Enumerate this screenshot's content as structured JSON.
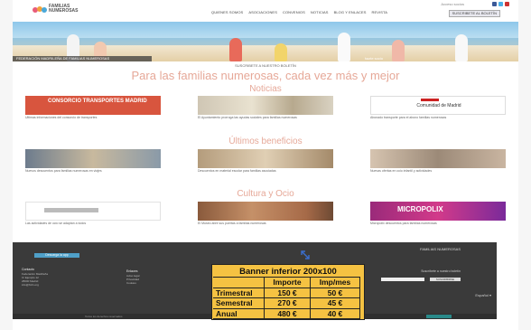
{
  "header": {
    "logo_text": "FAMILIAS NUMEROSAS",
    "top_links": "Acceso socios",
    "nav": [
      "QUIENES SOMOS",
      "ASOCIACIONES",
      "CONVENIOS",
      "NOTICIAS",
      "BLOG Y ENLACES",
      "REVISTA"
    ],
    "subscribe_button": "SUSCRIBETE AL BOLETÍN"
  },
  "hero": {
    "caption": "FEDERACIÓN MADRILEÑA DE FAMILIAS NUMEROSAS",
    "right_caption": "hazte socio"
  },
  "subscribe_line": "SUSCRIBETE A NUESTRO BOLETÍN",
  "tagline": "Para las familias numerosas, cada vez más y mejor",
  "sections": {
    "news_title": "Noticias",
    "benefits_title": "Últimos beneficios",
    "culture_title": "Cultura y Ocio"
  },
  "news": [
    {
      "label": "CONSORCIO TRANSPORTES MADRID",
      "text": "Ultimas informaciones del consorcio de transportes"
    },
    {
      "label": "",
      "text": "El Ayuntamiento prorroga las ayudas sociales para familias numerosas"
    },
    {
      "label": "Comunidad de Madrid",
      "text": "Abonado transporte para el abono familias numerosas"
    }
  ],
  "benefits": [
    {
      "text": "Nuevos descuentos para familias numerosas en viajes"
    },
    {
      "text": "Descuentos en material escolar para familias asociadas"
    },
    {
      "text": "Nuevas ofertas en ocio infantil y actividades"
    }
  ],
  "culture": [
    {
      "label": "",
      "text": "Las actividades de ocio se adaptan a todos"
    },
    {
      "label": "",
      "text": "El Museo abre sus puertas a familias numerosas"
    },
    {
      "label": "MICROPOLIX",
      "text": "Micropolix descuentos para familias numerosas"
    }
  ],
  "footer": {
    "app_button": "Descarga la app",
    "col1_head": "Contacto",
    "col1_lines": [
      "Federación Madrileña",
      "C/ Ejemplo 12",
      "28000 Madrid",
      "info@fmfn.org"
    ],
    "col2_head": "Enlaces",
    "col2_lines": [
      "Aviso legal",
      "Privacidad",
      "Cookies"
    ],
    "newsletter_label": "Suscríbete a nuestro boletín",
    "newsletter_button": "SUSCRIBIRSE",
    "lang": "Español ▾",
    "bottom_text": "Todos los derechos reservados"
  },
  "ad": {
    "title": "Banner inferior 200x100",
    "headers": [
      "",
      "Importe",
      "Imp/mes"
    ],
    "rows": [
      [
        "Trimestral",
        "150 €",
        "50 €"
      ],
      [
        "Semestral",
        "270 €",
        "45 €"
      ],
      [
        "Anual",
        "480 €",
        "40 €"
      ]
    ]
  },
  "colors": {
    "accent": "#e6a898",
    "ad_bg": "#f5c242",
    "footer_bg": "#3a3a3a"
  }
}
